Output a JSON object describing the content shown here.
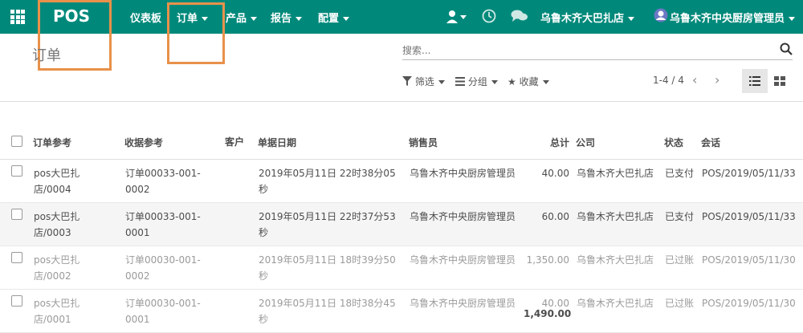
{
  "topbar": {
    "brand": "POS",
    "menus": [
      "仪表板",
      "订单",
      "产品",
      "报告",
      "配置"
    ],
    "company": "乌鲁木齐大巴扎店",
    "user": "乌鲁木齐中央厨房管理员"
  },
  "breadcrumb": "订单",
  "search": {
    "placeholder": "搜索..."
  },
  "filters": {
    "filter": "筛选",
    "group": "分组",
    "favorite": "收藏"
  },
  "pager": {
    "range": "1-4 / 4"
  },
  "table": {
    "columns": [
      "订单参考",
      "收据参考",
      "客户",
      "单据日期",
      "销售员",
      "总计",
      "公司",
      "状态",
      "会话"
    ],
    "rows": [
      {
        "ref_a": "pos大巴扎",
        "ref_b": "店/0004",
        "rcpt_a": "订单00033-001-",
        "rcpt_b": "0002",
        "date_a": "2019年05月11日 22时38分05",
        "date_b": "秒",
        "salesperson": "乌鲁木齐中央厨房管理员",
        "total": "40.00",
        "company": "乌鲁木齐大巴扎店",
        "state": "已支付",
        "session": "POS/2019/05/11/33"
      },
      {
        "ref_a": "pos大巴扎",
        "ref_b": "店/0003",
        "rcpt_a": "订单00033-001-",
        "rcpt_b": "0001",
        "date_a": "2019年05月11日 22时37分53",
        "date_b": "秒",
        "salesperson": "乌鲁木齐中央厨房管理员",
        "total": "60.00",
        "company": "乌鲁木齐大巴扎店",
        "state": "已支付",
        "session": "POS/2019/05/11/33"
      },
      {
        "ref_a": "pos大巴扎",
        "ref_b": "店/0002",
        "rcpt_a": "订单00030-001-",
        "rcpt_b": "0002",
        "date_a": "2019年05月11日 18时39分50",
        "date_b": "秒",
        "salesperson": "乌鲁木齐中央厨房管理员",
        "total": "1,350.00",
        "company": "乌鲁木齐大巴扎店",
        "state": "已过账",
        "session": "POS/2019/05/11/30"
      },
      {
        "ref_a": "pos大巴扎",
        "ref_b": "店/0001",
        "rcpt_a": "订单00030-001-",
        "rcpt_b": "0001",
        "date_a": "2019年05月11日 18时38分45",
        "date_b": "秒",
        "salesperson": "乌鲁木齐中央厨房管理员",
        "total": "40.00",
        "company": "乌鲁木齐大巴扎店",
        "state": "已过账",
        "session": "POS/2019/05/11/30"
      }
    ],
    "sum_total": "1,490.00"
  },
  "colors": {
    "topbar": "#00897b",
    "highlight": "#e8914a"
  }
}
